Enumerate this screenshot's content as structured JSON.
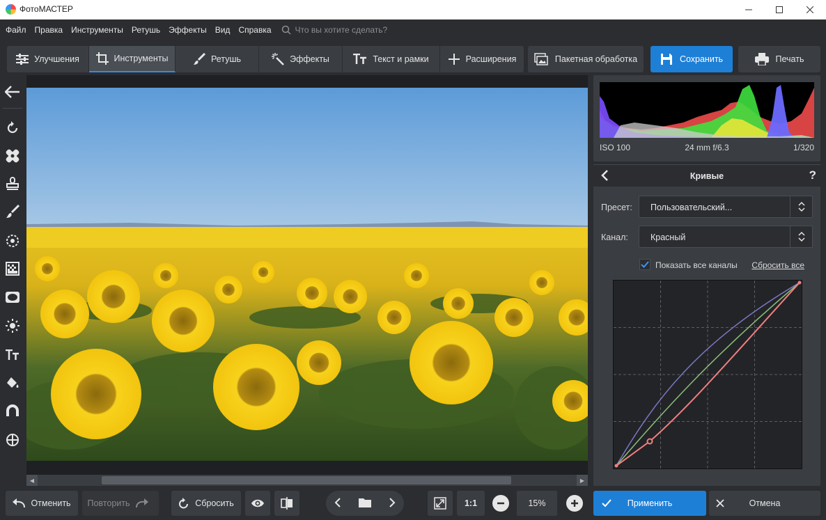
{
  "window": {
    "title": "ФотоМАСТЕР"
  },
  "menu": {
    "items": [
      "Файл",
      "Правка",
      "Инструменты",
      "Ретушь",
      "Эффекты",
      "Вид",
      "Справка"
    ],
    "search_placeholder": "Что вы хотите сделать?"
  },
  "tabs": [
    {
      "label": "Улучшения",
      "icon": "sliders-icon"
    },
    {
      "label": "Инструменты",
      "icon": "crop-icon",
      "active": true
    },
    {
      "label": "Ретушь",
      "icon": "brush-icon"
    },
    {
      "label": "Эффекты",
      "icon": "magic-wand-icon"
    },
    {
      "label": "Текст и рамки",
      "icon": "text-icon"
    },
    {
      "label": "Расширения",
      "icon": "plus-icon"
    }
  ],
  "toolbar": {
    "batch_label": "Пакетная обработка",
    "save_label": "Сохранить",
    "print_label": "Печать"
  },
  "sidebar": {
    "icons": [
      "back-arrow-icon",
      "rotate-icon",
      "bandage-icon",
      "stamp-icon",
      "brush-icon",
      "radial-icon",
      "gradient-icon",
      "vignette-icon",
      "light-icon",
      "text-icon",
      "fill-icon",
      "magnet-icon",
      "target-icon"
    ]
  },
  "histogram": {
    "iso": "ISO 100",
    "lens": "24 mm f/6.3",
    "shutter": "1/320"
  },
  "curves": {
    "title": "Кривые",
    "help": "?",
    "preset_label": "Пресет:",
    "preset_value": "Пользовательский...",
    "channel_label": "Канал:",
    "channel_value": "Красный",
    "show_all_label": "Показать все каналы",
    "show_all_checked": true,
    "reset_all_label": "Сбросить все",
    "curve_color_red": "#f07f7f",
    "curve_color_green": "#8bbf7a",
    "curve_color_blue": "#7a78c4"
  },
  "bottom": {
    "undo_label": "Отменить",
    "redo_label": "Повторить",
    "reset_label": "Сбросить",
    "one_to_one": "1:1",
    "zoom": "15%",
    "apply_label": "Применить",
    "cancel_label": "Отмена"
  },
  "colors": {
    "accent": "#1e7fd6",
    "bg": "#2b2d31",
    "panel": "#3a3d42"
  }
}
